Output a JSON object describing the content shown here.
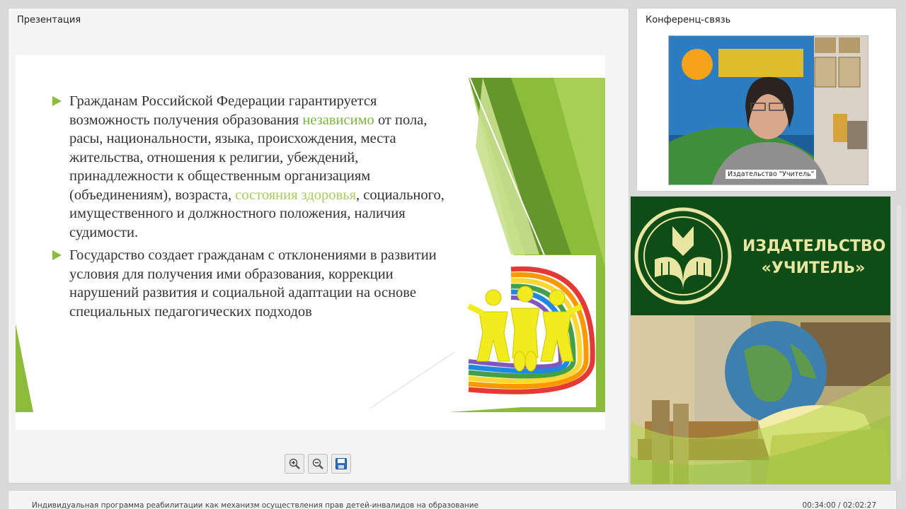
{
  "presentation": {
    "title": "Презентация",
    "slide": {
      "bullet1": {
        "before": "Гражданам Российской Федерации гарантируется возможность получения образования ",
        "highlight1": "независимо",
        "middle": " от пола, расы, национальности, языка, происхождения, места жительства, отношения к религии, убеждений, принадлежности к общественным организациям (объединениям), возраста, ",
        "highlight2": "состояния здоровья",
        "after": ", социального, имущественного и должностного положения, наличия судимости."
      },
      "bullet2": "Государство создает гражданам с отклонениями в развитии условия для получения ими образования, коррекции нарушений развития и социальной адаптации на основе специальных педагогических подходов"
    },
    "toolbar": {
      "zoom_in_icon": "zoom-in-icon",
      "zoom_out_icon": "zoom-out-icon",
      "save_icon": "save-icon"
    }
  },
  "conference": {
    "title": "Конференц-связь",
    "video_label": "Издательство \"Учитель\""
  },
  "brand": {
    "line1": "ИЗДАТЕЛЬСТВО",
    "line2": "«УЧИТЕЛЬ»"
  },
  "footer": {
    "title": "Индивидуальная программа реабилитации как механизм осуществления прав детей-инвалидов на образование",
    "time": "00:34:00 / 02:02:27"
  },
  "colors": {
    "accent_green": "#7db53c",
    "brand_dark_green": "#0f4d16",
    "brand_text": "#e8e6a2"
  }
}
